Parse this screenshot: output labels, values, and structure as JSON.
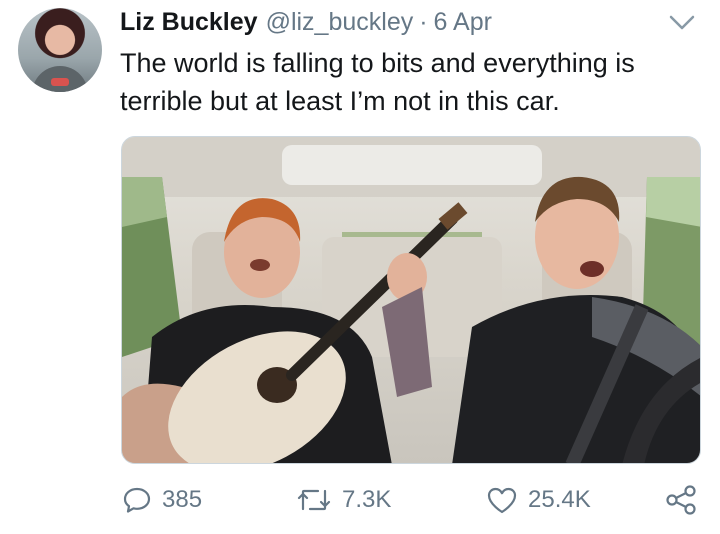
{
  "tweet": {
    "author_name": "Liz Buckley",
    "handle": "@liz_buckley",
    "separator": "·",
    "date": "6 Apr",
    "text": "The world is falling to bits and everything is terrible but at least I’m not in this car."
  },
  "icons": {
    "menu": "chevron-down-icon",
    "reply": "comment-icon",
    "retweet": "retweet-icon",
    "like": "heart-icon",
    "share": "share-icon"
  },
  "actions": {
    "reply_count": "385",
    "retweet_count": "7.3K",
    "like_count": "25.4K"
  },
  "colors": {
    "text": "#14171a",
    "secondary": "#657786"
  }
}
